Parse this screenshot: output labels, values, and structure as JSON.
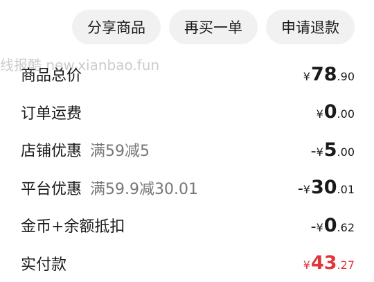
{
  "actions": {
    "share": "分享商品",
    "rebuy": "再买一单",
    "refund": "申请退款"
  },
  "watermark": "线报酷 new.xianbao.fun",
  "rows": [
    {
      "label": "商品总价",
      "sub": "",
      "sign": "",
      "currency": "¥",
      "int": "78",
      "dec": ".90"
    },
    {
      "label": "订单运费",
      "sub": "",
      "sign": "",
      "currency": "¥",
      "int": "0",
      "dec": ".00"
    },
    {
      "label": "店铺优惠",
      "sub": "满59减5",
      "sign": "-",
      "currency": "¥",
      "int": "5",
      "dec": ".00"
    },
    {
      "label": "平台优惠",
      "sub": "满59.9减30.01",
      "sign": "-",
      "currency": "¥",
      "int": "30",
      "dec": ".01"
    },
    {
      "label": "金币+余额抵扣",
      "sub": "",
      "sign": "-",
      "currency": "¥",
      "int": "0",
      "dec": ".62"
    },
    {
      "label": "实付款",
      "sub": "",
      "sign": "",
      "currency": "¥",
      "int": "43",
      "dec": ".27"
    }
  ],
  "colors": {
    "accent_red": "#e0353b",
    "pill_bg": "#f1f1f1"
  }
}
